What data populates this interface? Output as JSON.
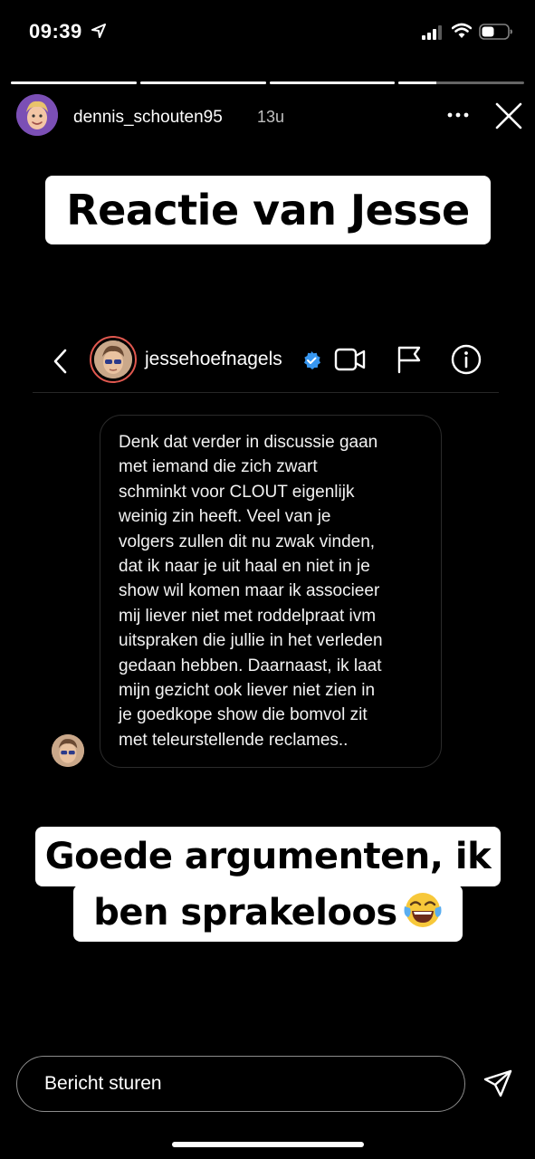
{
  "status_bar": {
    "time": "09:39",
    "icons": [
      "location-arrow-icon",
      "cellular-signal-icon",
      "wifi-icon",
      "battery-icon"
    ]
  },
  "story_progress": [
    1,
    1,
    1,
    0.3
  ],
  "story_header": {
    "username": "dennis_schouten95",
    "time_ago": "13u",
    "icons": [
      "more-icon",
      "close-icon"
    ]
  },
  "sticker_top": {
    "text": "Reactie van Jesse"
  },
  "dm_header": {
    "username": "jessehoefnagels",
    "icons": [
      "chevron-left-icon",
      "verified-badge-icon",
      "video-call-icon",
      "flag-icon",
      "info-icon"
    ]
  },
  "message": {
    "text": "Denk dat verder in discussie gaan\nmet iemand die zich zwart\nschminkt voor CLOUT eigenlijk\nweinig zin heeft. Veel van je\nvolgers zullen dit nu zwak vinden,\ndat ik naar je uit haal en niet in je\nshow wil komen maar ik associeer\nmij liever niet met roddelpraat ivm\nuitspraken die jullie in het verleden\ngedaan hebben. Daarnaast, ik laat\nmijn gezicht ook liever niet zien in\nje goedkope show die bomvol zit\nmet teleurstellende reclames.."
  },
  "sticker_bottom": {
    "line1": "Goede argumenten, ik",
    "line2": "ben sprakeloos",
    "emoji": "face-with-tears-of-joy-icon"
  },
  "reply": {
    "placeholder": "Bericht sturen",
    "send_icon": "send-icon"
  },
  "colors": {
    "background": "#000000",
    "verified": "#3897f0",
    "story_avatar": "#7b4fb5",
    "dm_avatar_ring": "#e0584f"
  }
}
